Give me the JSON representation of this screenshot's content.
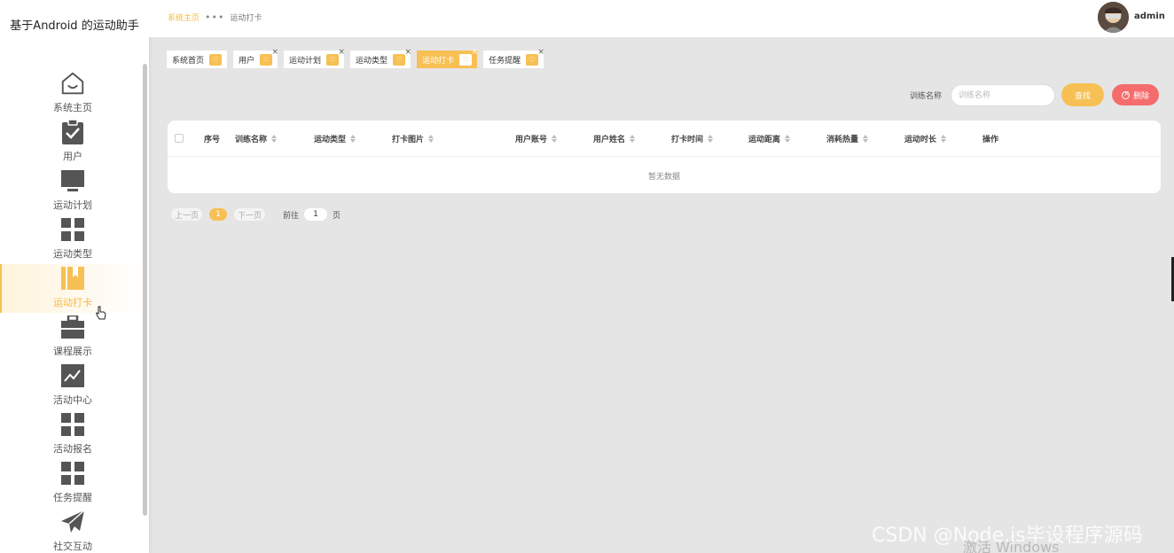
{
  "app": {
    "title": "基于Android 的运动助手"
  },
  "sidebar": {
    "items": [
      {
        "label": "系统主页",
        "icon": "home-icon"
      },
      {
        "label": "用户",
        "icon": "clipboard-check-icon"
      },
      {
        "label": "运动计划",
        "icon": "monitor-icon"
      },
      {
        "label": "运动类型",
        "icon": "grid-icon"
      },
      {
        "label": "运动打卡",
        "icon": "bookmark-icon",
        "active": true
      },
      {
        "label": "课程展示",
        "icon": "briefcase-icon"
      },
      {
        "label": "活动中心",
        "icon": "trend-chart-icon"
      },
      {
        "label": "活动报名",
        "icon": "grid-icon"
      },
      {
        "label": "任务提醒",
        "icon": "grid-icon"
      },
      {
        "label": "社交互动",
        "icon": "paper-plane-icon"
      }
    ]
  },
  "header": {
    "breadcrumb": {
      "home": "系统主页",
      "separator": "•••",
      "current": "运动打卡"
    },
    "user": {
      "name": "admin"
    }
  },
  "tabs": [
    {
      "label": "系统首页",
      "closable": false
    },
    {
      "label": "用户",
      "closable": true
    },
    {
      "label": "运动计划",
      "closable": true
    },
    {
      "label": "运动类型",
      "closable": true
    },
    {
      "label": "运动打卡",
      "closable": true,
      "active": true
    },
    {
      "label": "任务提醒",
      "closable": true
    }
  ],
  "search": {
    "label": "训练名称",
    "placeholder": "训练名称",
    "search_button": "查找",
    "delete_button": "删除"
  },
  "table": {
    "columns": [
      "序号",
      "训练名称",
      "运动类型",
      "打卡图片",
      "用户账号",
      "用户姓名",
      "打卡时间",
      "运动距离",
      "消耗热量",
      "运动时长",
      "操作"
    ],
    "empty_text": "暂无数据"
  },
  "pagination": {
    "prev": "上一页",
    "current_page": "1",
    "next": "下一页",
    "goto_label": "前往",
    "goto_value": "1",
    "goto_unit": "页"
  },
  "watermarks": {
    "csdn": "CSDN @Node.js毕设程序源码",
    "windows": "激活 Windows"
  },
  "colors": {
    "accent": "#f7c054",
    "danger": "#f56c6c",
    "background": "#e5e5e5"
  }
}
